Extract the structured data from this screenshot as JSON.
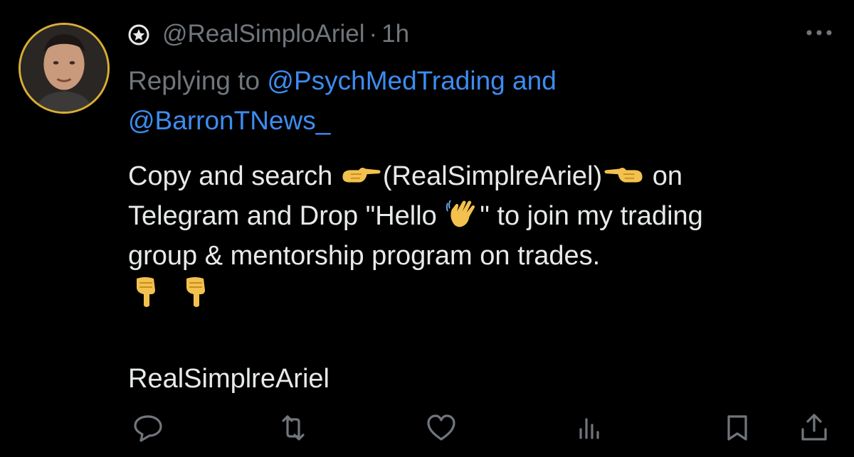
{
  "tweet": {
    "handle": "@RealSimploAriel",
    "separator": "·",
    "time": "1h",
    "replying_prefix": "Replying to",
    "reply_mention_1": "@PsychMedTrading",
    "reply_and": "and",
    "reply_mention_2": "@BarronTNews_",
    "body_part_1": "Copy and search ",
    "body_part_2": "(RealSimplreAriel)",
    "body_part_3": " on",
    "body_line_2a": "Telegram and Drop \"Hello ",
    "body_line_2b": "\" to join my trading",
    "body_line_3": "group & mentorship program on trades.",
    "handle_line": "RealSimplreAriel"
  },
  "icons": {
    "badge": "star-badge-icon",
    "more": "more-dots-icon",
    "pointing_right": "pointing-right-emoji",
    "pointing_left": "pointing-left-emoji",
    "waving_hand": "waving-hand-emoji",
    "pointing_down": "pointing-down-emoji",
    "reply": "reply-icon",
    "retweet": "retweet-icon",
    "like": "heart-icon",
    "views": "views-chart-icon",
    "bookmark": "bookmark-icon",
    "share": "share-icon"
  },
  "colors": {
    "background": "#000000",
    "primary_text": "#e7e9ea",
    "secondary_text": "#71767b",
    "mention": "#3d8cf0",
    "avatar_ring": "#d9ae35",
    "emoji": "#f2c14e"
  }
}
